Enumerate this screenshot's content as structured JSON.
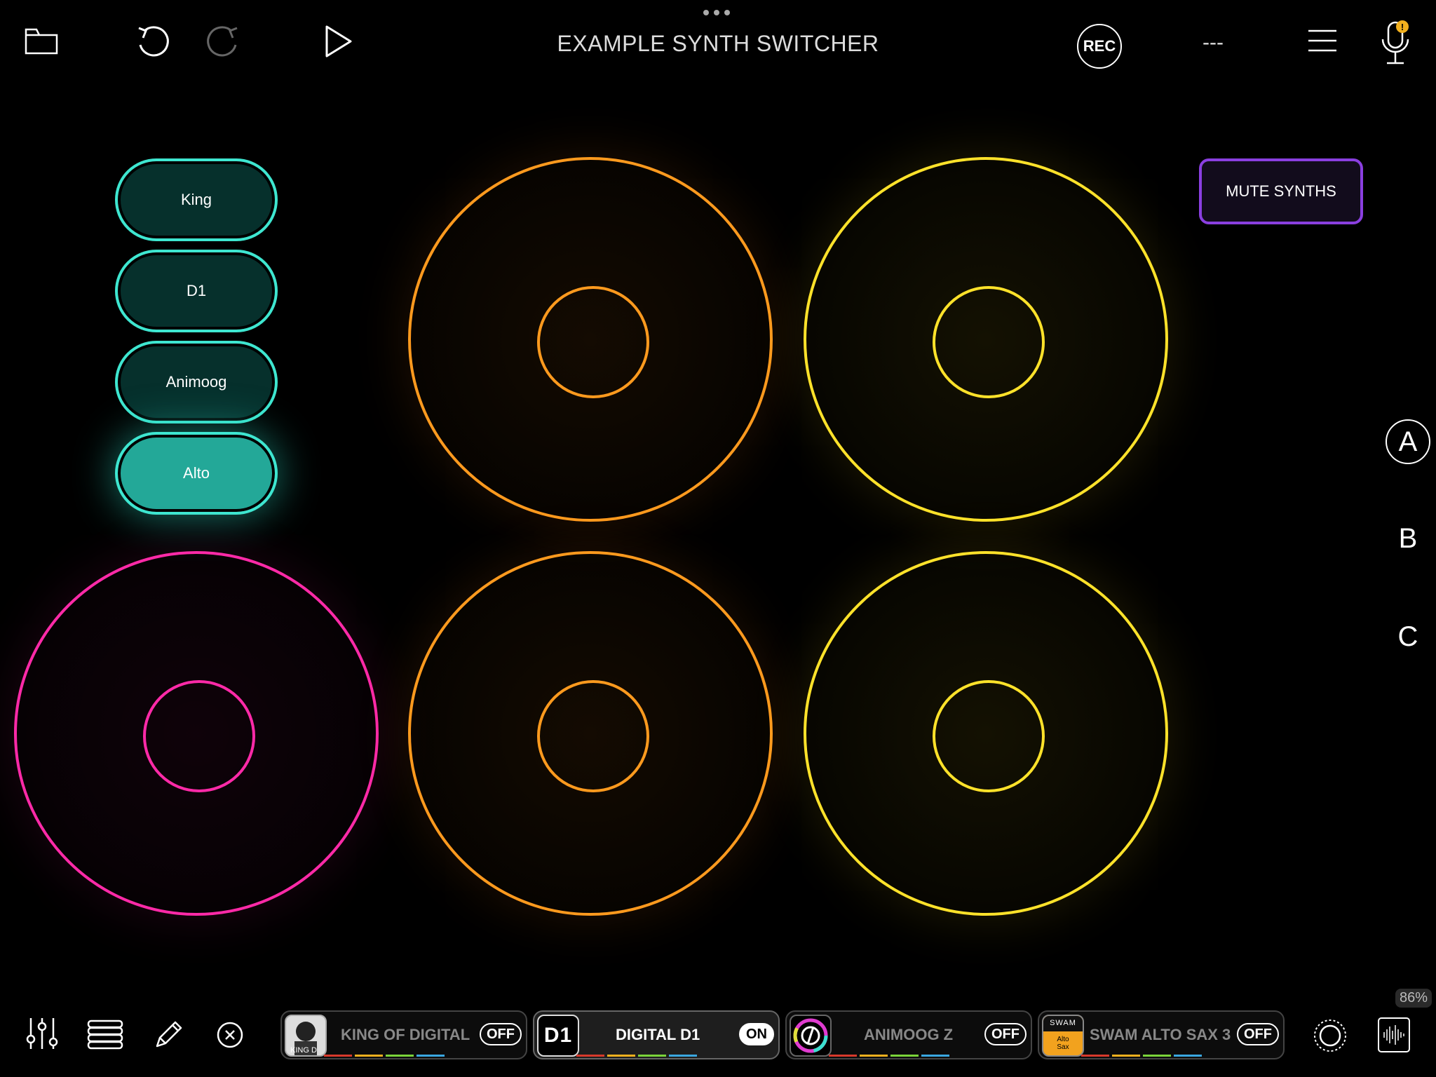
{
  "header": {
    "title": "EXAMPLE SYNTH SWITCHER",
    "rec_label": "REC",
    "status_text": "---",
    "icons": [
      "folder-icon",
      "undo-icon",
      "redo-icon",
      "play-icon",
      "menu-icon",
      "microphone-icon"
    ]
  },
  "selectors": [
    {
      "label": "King",
      "active": false
    },
    {
      "label": "D1",
      "active": false
    },
    {
      "label": "Animoog",
      "active": false
    },
    {
      "label": "Alto",
      "active": true
    }
  ],
  "mute_button": {
    "label": "MUTE SYNTHS"
  },
  "banks": [
    "A",
    "B",
    "C"
  ],
  "colors": {
    "teal": "#3ee6d0",
    "pink": "#ff2aa8",
    "orange": "#ff9a1e",
    "yellow": "#ffe22a",
    "purple": "#8a3fe0"
  },
  "bottom_bar": {
    "tools": [
      "mixer-icon",
      "layers-icon",
      "pencil-icon",
      "close-icon"
    ],
    "slots": [
      {
        "name": "KING OF DIGITAL",
        "state": "OFF",
        "thumb_label": "KING D"
      },
      {
        "name": "DIGITAL D1",
        "state": "ON",
        "thumb_label": "D1"
      },
      {
        "name": "ANIMOOG Z",
        "state": "OFF",
        "thumb_label": ""
      },
      {
        "name": "SWAM ALTO SAX 3",
        "state": "OFF",
        "thumb_label": "SWAM",
        "thumb_sub": "Alto Sax"
      }
    ],
    "percent": "86%"
  }
}
